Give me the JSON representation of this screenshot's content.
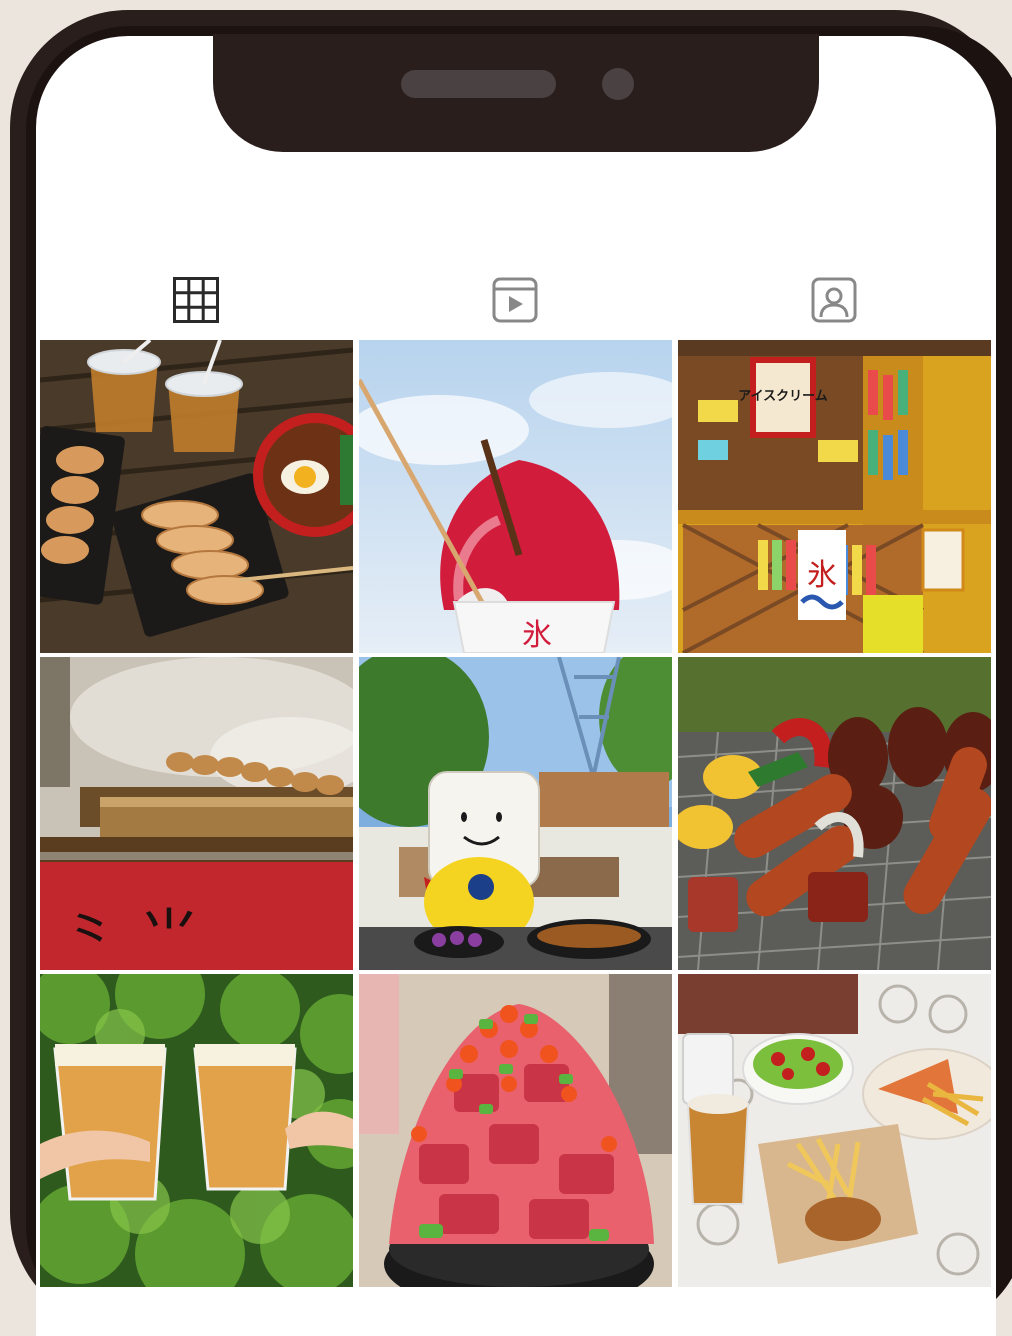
{
  "profile": {
    "tabs": [
      {
        "id": "posts",
        "icon": "grid-icon",
        "selected": true
      },
      {
        "id": "reels",
        "icon": "play-square-icon",
        "selected": false
      },
      {
        "id": "tagged",
        "icon": "person-tag-icon",
        "selected": false
      }
    ]
  },
  "feed": {
    "posts": [
      {
        "subject": "gyoza-beer-braised-pork-rice",
        "sign_text": ""
      },
      {
        "subject": "shaved-ice-strawberry",
        "sign_text": "氷"
      },
      {
        "subject": "festival-food-stall",
        "sign_text": "アイスクリーム",
        "banner_text": "氷"
      },
      {
        "subject": "yakitori-grill",
        "sign_text": ""
      },
      {
        "subject": "tofu-mascot-skytree",
        "sign_text": ""
      },
      {
        "subject": "bbq-sausage-grill",
        "sign_text": ""
      },
      {
        "subject": "beer-toast",
        "sign_text": ""
      },
      {
        "subject": "tuna-ikura-bowl",
        "sign_text": ""
      },
      {
        "subject": "beer-salad-pizza-fries",
        "sign_text": ""
      }
    ]
  },
  "colors": {
    "background": "#ece5dd",
    "phone_frame": "#2a1e1c",
    "icon_stroke": "#2a2a2a",
    "icon_inactive": "#888888"
  }
}
